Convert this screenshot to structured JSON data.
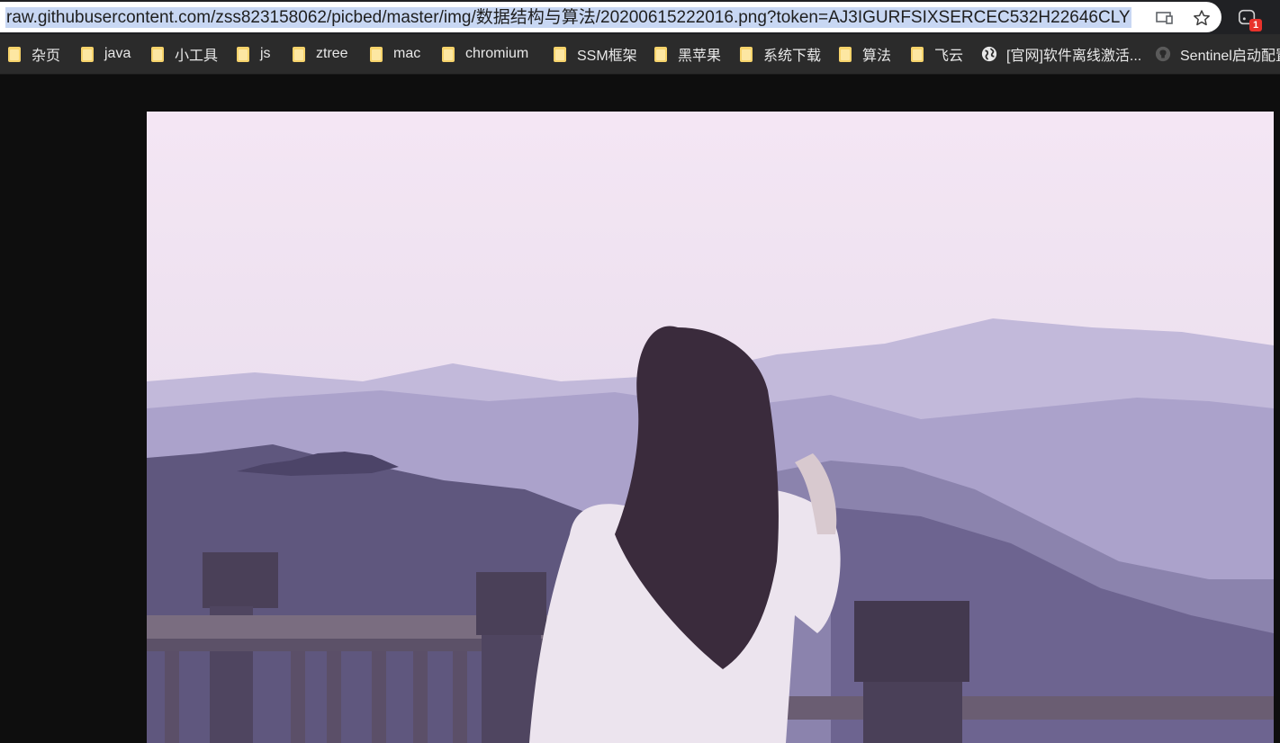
{
  "address_bar": {
    "url": "raw.githubusercontent.com/zss823158062/picbed/master/img/数据结构与算法/20200615222016.png?token=AJ3IGURFSIXSERCEC532H22646CLY",
    "cast_icon": "cast-icon",
    "star_icon": "bookmark-star-icon",
    "extension_icon": "extension-icon",
    "extension_badge": "1"
  },
  "bookmarks": [
    {
      "label": "杂页",
      "icon": "folder-icon"
    },
    {
      "label": "java",
      "icon": "folder-icon"
    },
    {
      "label": "小工具",
      "icon": "folder-icon"
    },
    {
      "label": "js",
      "icon": "folder-icon"
    },
    {
      "label": "ztree",
      "icon": "folder-icon"
    },
    {
      "label": "mac",
      "icon": "folder-icon"
    },
    {
      "label": "chromium",
      "icon": "folder-icon"
    },
    {
      "label": "SSM框架",
      "icon": "folder-icon"
    },
    {
      "label": "黑苹果",
      "icon": "folder-icon"
    },
    {
      "label": "系统下载",
      "icon": "folder-icon"
    },
    {
      "label": "算法",
      "icon": "folder-icon"
    },
    {
      "label": "飞云",
      "icon": "folder-icon"
    },
    {
      "label": "[官网]软件离线激活...",
      "icon": "globe-icon"
    },
    {
      "label": "Sentinel启动配置",
      "icon": "github-icon"
    }
  ],
  "image": {
    "subject": "photo"
  },
  "colors": {
    "background": "#0e0e0e",
    "bookmarks_bar": "#2b2b2b",
    "url_selection": "#c8d7f3"
  }
}
